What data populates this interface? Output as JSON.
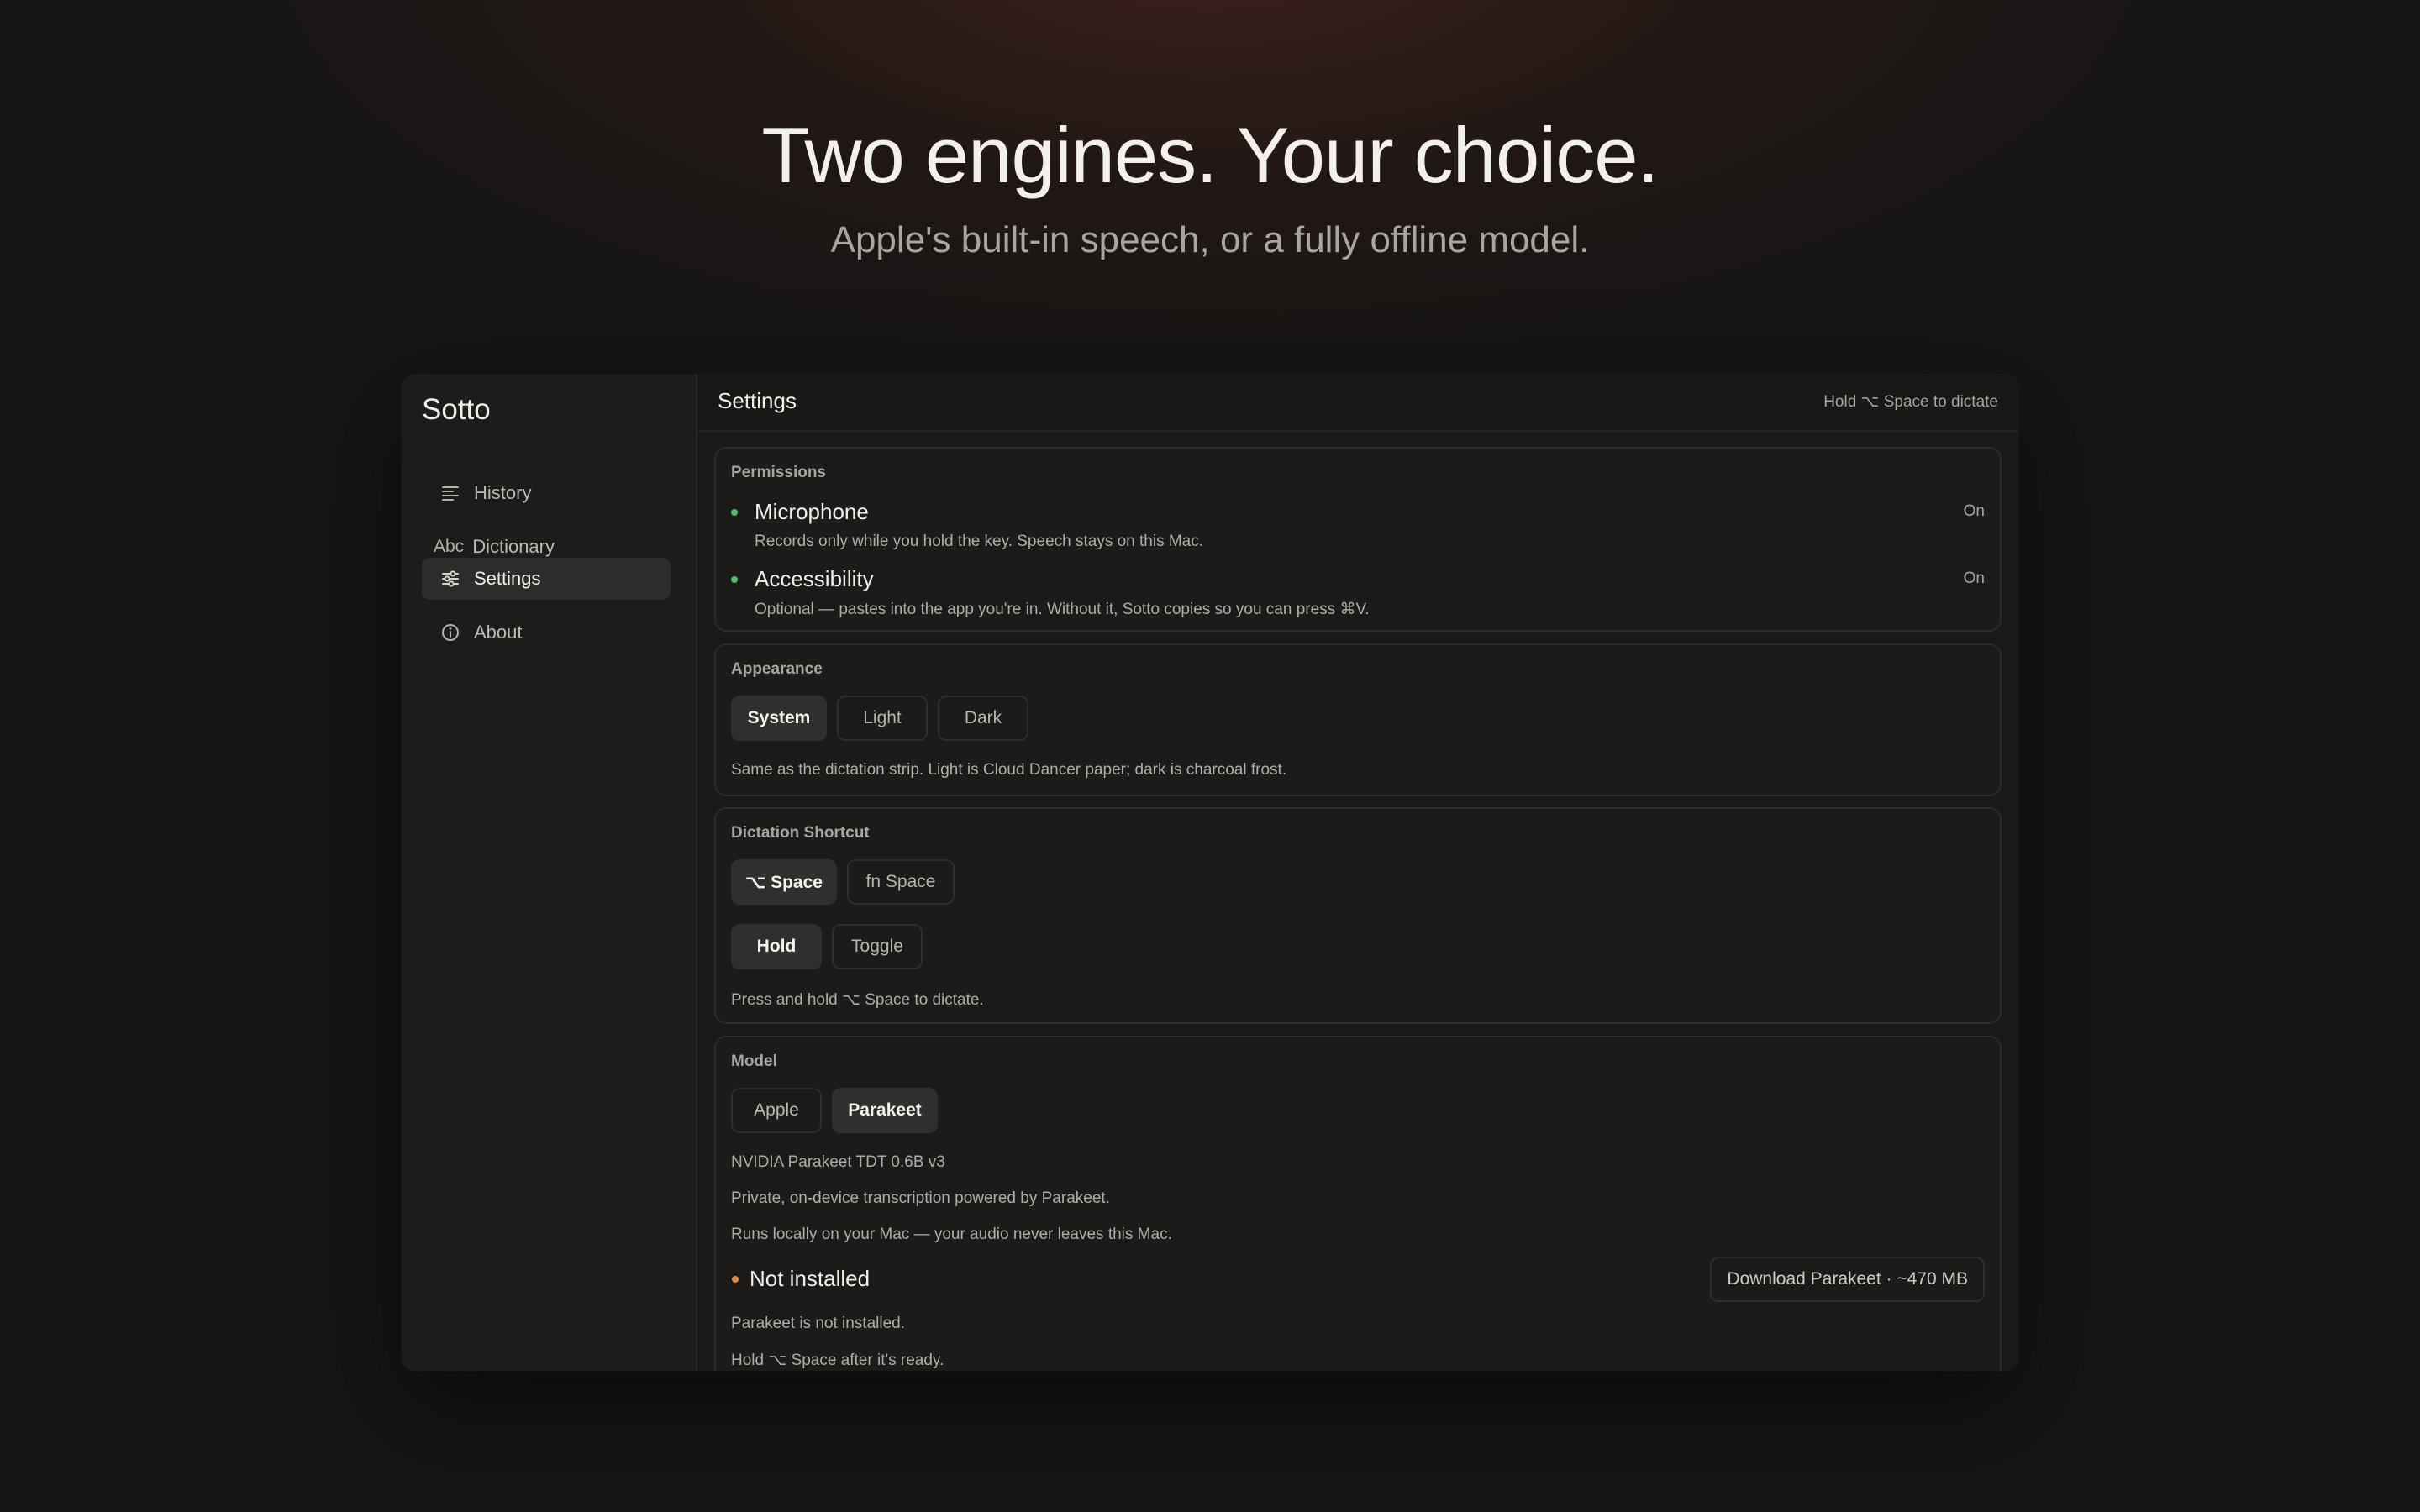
{
  "hero": {
    "headline": "Two engines. Your choice.",
    "subheadline": "Apple's built-in speech, or a fully offline model."
  },
  "sidebar": {
    "app_title": "Sotto",
    "items": [
      {
        "label": "History",
        "icon": "list-icon",
        "active": false
      },
      {
        "label": "Dictionary",
        "icon": "Abc",
        "active": false
      },
      {
        "label": "Settings",
        "icon": "sliders-icon",
        "active": true
      },
      {
        "label": "About",
        "icon": "info-icon",
        "active": false
      }
    ]
  },
  "topbar": {
    "title": "Settings",
    "hint": "Hold ⌥ Space to dictate"
  },
  "permissions": {
    "title": "Permissions",
    "items": [
      {
        "name": "Microphone",
        "description": "Records only while you hold the key. Speech stays on this Mac.",
        "state": "On",
        "status_color": "#4cc26b"
      },
      {
        "name": "Accessibility",
        "description": "Optional — pastes into the app you're in. Without it, Sotto copies so you can press ⌘V.",
        "state": "On",
        "status_color": "#4cc26b"
      }
    ]
  },
  "appearance": {
    "title": "Appearance",
    "options": [
      "System",
      "Light",
      "Dark"
    ],
    "selected": "System",
    "description": "Same as the dictation strip. Light is Cloud Dancer paper; dark is charcoal frost."
  },
  "shortcut": {
    "title": "Dictation Shortcut",
    "key_options": [
      "⌥ Space",
      "fn Space"
    ],
    "key_selected": "⌥ Space",
    "mode_options": [
      "Hold",
      "Toggle"
    ],
    "mode_selected": "Hold",
    "description": "Press and hold ⌥ Space to dictate."
  },
  "model": {
    "title": "Model",
    "options": [
      "Apple",
      "Parakeet"
    ],
    "selected": "Parakeet",
    "name": "NVIDIA Parakeet TDT 0.6B v3",
    "line1": "Private, on-device transcription powered by Parakeet.",
    "line2": "Runs locally on your Mac — your audio never leaves this Mac.",
    "status": "Not installed",
    "status_color": "#e8893a",
    "download_label": "Download Parakeet · ~470 MB",
    "note1": "Parakeet is not installed.",
    "note2": "Hold ⌥ Space after it's ready."
  },
  "colors": {
    "background": "#171615",
    "window": "#1a1918",
    "accent_green": "#4cc26b",
    "accent_orange": "#e8893a"
  }
}
